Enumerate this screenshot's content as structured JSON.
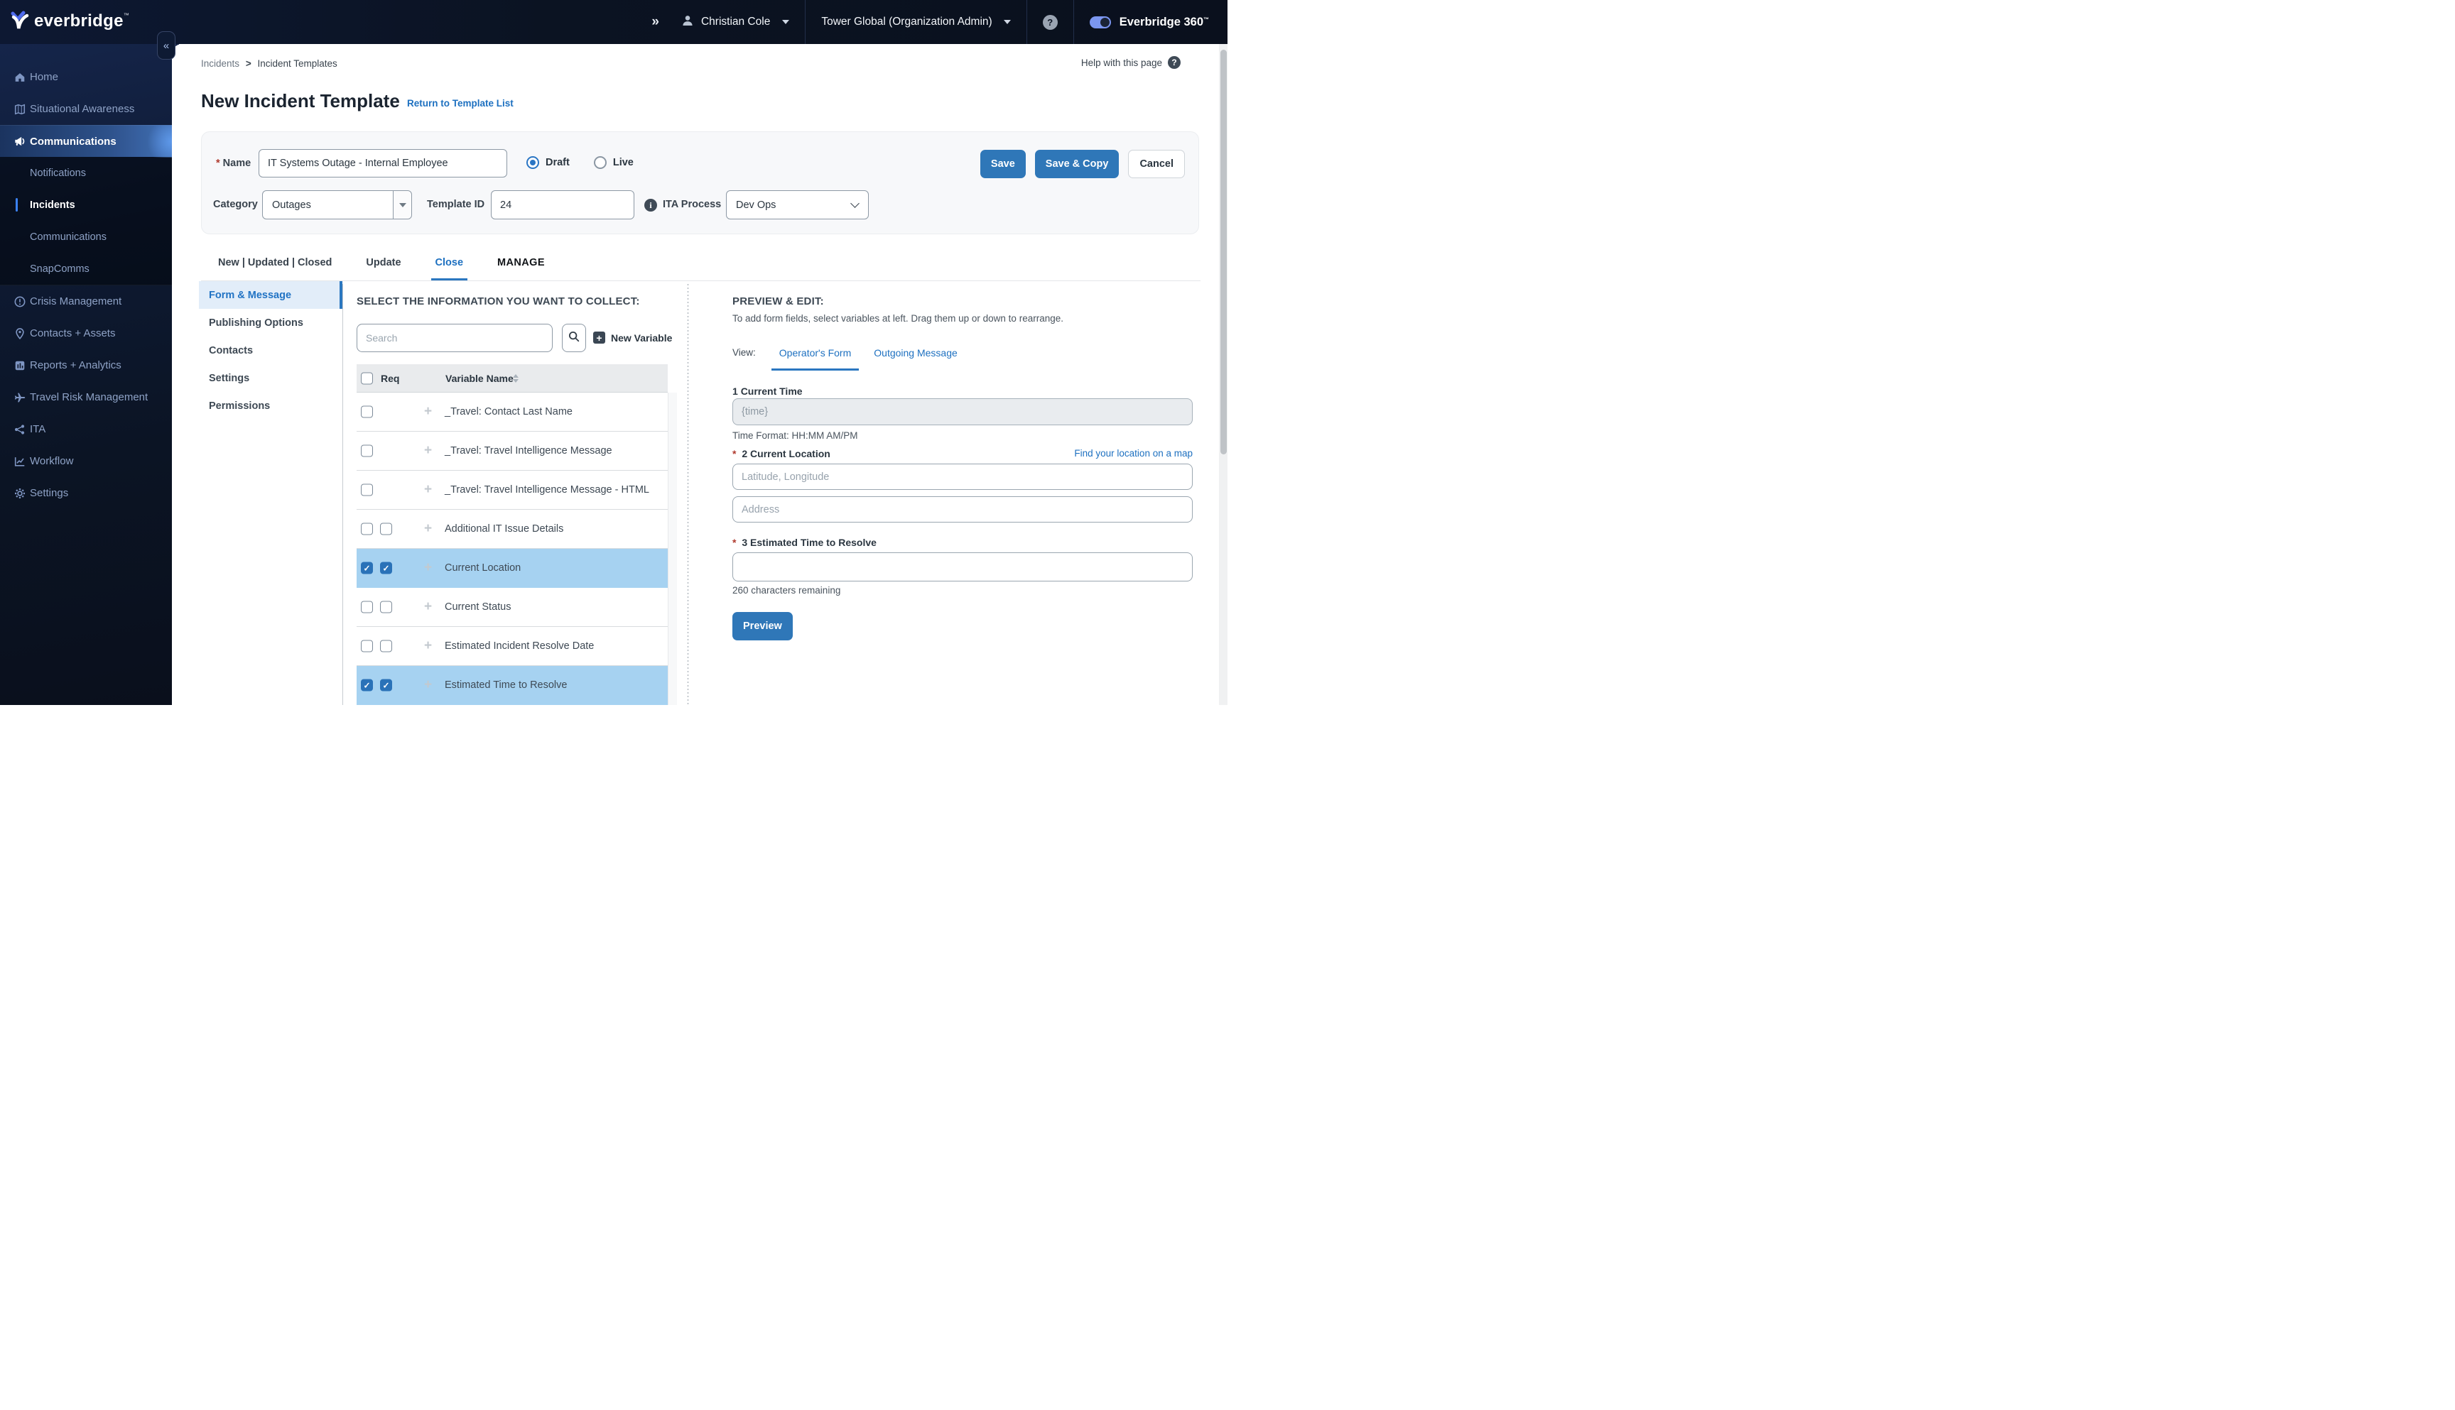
{
  "header": {
    "brand": "everbridge",
    "brand_tm": "™",
    "collapse_icon": "«",
    "expand_icon": "»",
    "user_name": "Christian Cole",
    "org_name": "Tower Global (Organization Admin)",
    "help_glyph": "?",
    "product": "Everbridge 360",
    "product_tm": "™"
  },
  "breadcrumb": {
    "parent": "Incidents",
    "sep": ">",
    "current": "Incident Templates"
  },
  "help_link": "Help with this page",
  "page": {
    "title": "New Incident Template",
    "return_link": "Return to Template List"
  },
  "form": {
    "name_label": "Name",
    "name_value": "IT Systems Outage - Internal Employee",
    "status_draft": "Draft",
    "status_live": "Live",
    "save_label": "Save",
    "save_copy_label": "Save & Copy",
    "cancel_label": "Cancel",
    "category_label": "Category",
    "category_value": "Outages",
    "template_id_label": "Template ID",
    "template_id_value": "24",
    "ita_label": "ITA Process",
    "ita_value": "Dev Ops"
  },
  "tabs": {
    "t1": "New | Updated | Closed",
    "t2": "Update",
    "t3": "Close",
    "t4": "MANAGE",
    "active": "Close"
  },
  "section_nav": {
    "items": [
      {
        "label": "Form & Message",
        "active": true
      },
      {
        "label": "Publishing Options",
        "active": false
      },
      {
        "label": "Contacts",
        "active": false
      },
      {
        "label": "Settings",
        "active": false
      },
      {
        "label": "Permissions",
        "active": false
      }
    ]
  },
  "collect": {
    "heading": "SELECT THE INFORMATION YOU WANT TO COLLECT:",
    "search_placeholder": "Search",
    "new_variable_label": "New Variable",
    "col_req": "Req",
    "col_variable": "Variable Name",
    "rows": [
      {
        "name": "_Travel: Contact Last Name",
        "req_visible": false,
        "selected": false
      },
      {
        "name": "_Travel: Travel Intelligence Message",
        "req_visible": false,
        "selected": false
      },
      {
        "name": "_Travel: Travel Intelligence Message - HTML",
        "req_visible": false,
        "selected": false
      },
      {
        "name": "Additional IT Issue Details",
        "req_visible": true,
        "selected": false
      },
      {
        "name": "Current Location",
        "req_visible": true,
        "selected": true
      },
      {
        "name": "Current Status",
        "req_visible": true,
        "selected": false
      },
      {
        "name": "Estimated Incident Resolve Date",
        "req_visible": true,
        "selected": false
      },
      {
        "name": "Estimated Time to Resolve",
        "req_visible": true,
        "selected": true
      }
    ]
  },
  "preview": {
    "heading": "PREVIEW & EDIT:",
    "subtext": "To add form fields, select variables at left. Drag them up or down to rearrange.",
    "view_label": "View:",
    "tab_operator": "Operator's Form",
    "tab_outgoing": "Outgoing Message",
    "f1": {
      "number": "1",
      "label": "Current Time",
      "value": "{time}",
      "note": "Time Format: HH:MM AM/PM"
    },
    "f2": {
      "number": "2",
      "label": "Current Location",
      "link": "Find your location on a map",
      "placeholder_latlong": "Latitude, Longitude",
      "placeholder_address": "Address"
    },
    "f3": {
      "number": "3",
      "label": "Estimated Time to Resolve",
      "note": "260 characters remaining"
    },
    "preview_button": "Preview"
  },
  "sidebar": {
    "items": [
      {
        "label": "Home"
      },
      {
        "label": "Situational Awareness"
      },
      {
        "label": "Communications",
        "active": true
      }
    ],
    "sub_items": [
      {
        "label": "Notifications"
      },
      {
        "label": "Incidents",
        "active": true
      },
      {
        "label": "Communications"
      },
      {
        "label": "SnapComms"
      }
    ],
    "items2": [
      {
        "label": "Crisis Management"
      },
      {
        "label": "Contacts + Assets"
      },
      {
        "label": "Reports + Analytics"
      },
      {
        "label": "Travel Risk Management"
      },
      {
        "label": "ITA"
      },
      {
        "label": "Workflow"
      },
      {
        "label": "Settings"
      }
    ]
  },
  "colors": {
    "accent_blue": "#1d70c0",
    "button_blue": "#2f77b8",
    "row_highlight": "#a6d2f1",
    "checkbox_checked": "#2a72b8",
    "active_nav_bg": "#e2edf9",
    "header_bg": "#0b1322",
    "sidebar_bg": "#0d1628",
    "toggle_blue": "#7b96f0"
  }
}
